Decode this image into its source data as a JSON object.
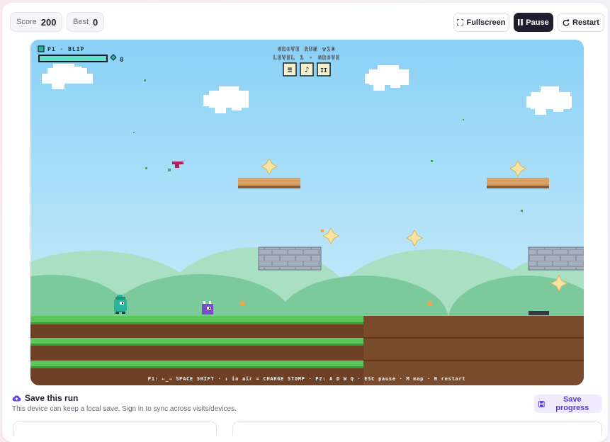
{
  "toolbar": {
    "score_label": "Score",
    "score_value": "200",
    "best_label": "Best",
    "best_value": "0",
    "fullscreen_label": "Fullscreen",
    "pause_label": "Pause",
    "restart_label": "Restart"
  },
  "hud": {
    "player_label": "P1 · BLIP",
    "gems_count": "0",
    "health_fraction": 1.0,
    "game_title": "GROVE RUN v10",
    "level_label": "LEVEL 1 · GROVE",
    "buttons": [
      "≡",
      "♪",
      "II"
    ],
    "controls_hint": "P1: ←_→ SPACE SHIFT · ↓ in air = CHARGE STOMP · P2: A D W Q · ESC pause · M map · R restart"
  },
  "save": {
    "title": "Save this run",
    "subtitle": "This device can keep a local save. Sign in to sync across visits/devices.",
    "button_label": "Save progress"
  },
  "colors": {
    "sky": "#8fd3f4",
    "grass": "#5cc65a",
    "dirt": "#7a4a2c",
    "accent": "#5b3fd6",
    "player": "#2bb3a0",
    "enemy": "#7b4bc8"
  }
}
